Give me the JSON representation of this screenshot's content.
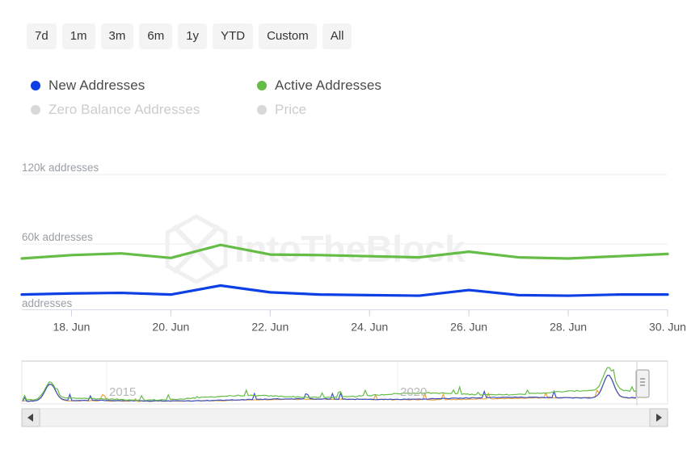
{
  "range_selector": {
    "buttons": [
      {
        "label": "7d",
        "selected": false
      },
      {
        "label": "1m",
        "selected": false
      },
      {
        "label": "3m",
        "selected": false
      },
      {
        "label": "6m",
        "selected": false
      },
      {
        "label": "1y",
        "selected": false
      },
      {
        "label": "YTD",
        "selected": false
      },
      {
        "label": "Custom",
        "selected": false
      },
      {
        "label": "All",
        "selected": false
      }
    ]
  },
  "legend": {
    "items": [
      {
        "label": "New Addresses",
        "color": "#0c3fe4",
        "enabled": true
      },
      {
        "label": "Active Addresses",
        "color": "#65bc46",
        "enabled": true
      },
      {
        "label": "Zero Balance Addresses",
        "color": "#d8d8d8",
        "enabled": false
      },
      {
        "label": "Price",
        "color": "#d8d8d8",
        "enabled": false
      }
    ]
  },
  "watermark": {
    "text": "IntoTheBlock",
    "logo": "hexagon-logo-icon"
  },
  "navigator": {
    "year_labels": [
      "2015",
      "2020"
    ],
    "scroll_left_icon": "triangle-left-icon",
    "scroll_right_icon": "triangle-right-icon",
    "handle_icon": "grip-handle-icon",
    "series_colors": [
      "#65bc46",
      "#0c3fe4",
      "#e8a33d"
    ]
  },
  "chart_data": {
    "type": "line",
    "title": "",
    "xlabel": "",
    "ylabel": "addresses",
    "grid": true,
    "legend_position": "top",
    "ylim": [
      0,
      150000
    ],
    "ytick_values": [
      0,
      60000,
      120000
    ],
    "ytick_labels": [
      "addresses",
      "60k addresses",
      "120k addresses"
    ],
    "xtick_labels": [
      "18. Jun",
      "20. Jun",
      "22. Jun",
      "24. Jun",
      "26. Jun",
      "28. Jun",
      "30. Jun"
    ],
    "x": [
      "17. Jun",
      "18. Jun",
      "19. Jun",
      "20. Jun",
      "21. Jun",
      "22. Jun",
      "23. Jun",
      "24. Jun",
      "25. Jun",
      "26. Jun",
      "27. Jun",
      "28. Jun",
      "29. Jun",
      "30. Jun"
    ],
    "series": [
      {
        "name": "Active Addresses",
        "color": "#65bc46",
        "values": [
          45500,
          48500,
          50000,
          46000,
          57500,
          49000,
          48500,
          47500,
          46500,
          51500,
          46500,
          45500,
          47500,
          49500
        ]
      },
      {
        "name": "New Addresses",
        "color": "#0c3fe4",
        "values": [
          13500,
          14500,
          15000,
          13500,
          21500,
          15500,
          13500,
          13000,
          12500,
          17500,
          13000,
          12500,
          13500,
          13500
        ]
      }
    ]
  }
}
